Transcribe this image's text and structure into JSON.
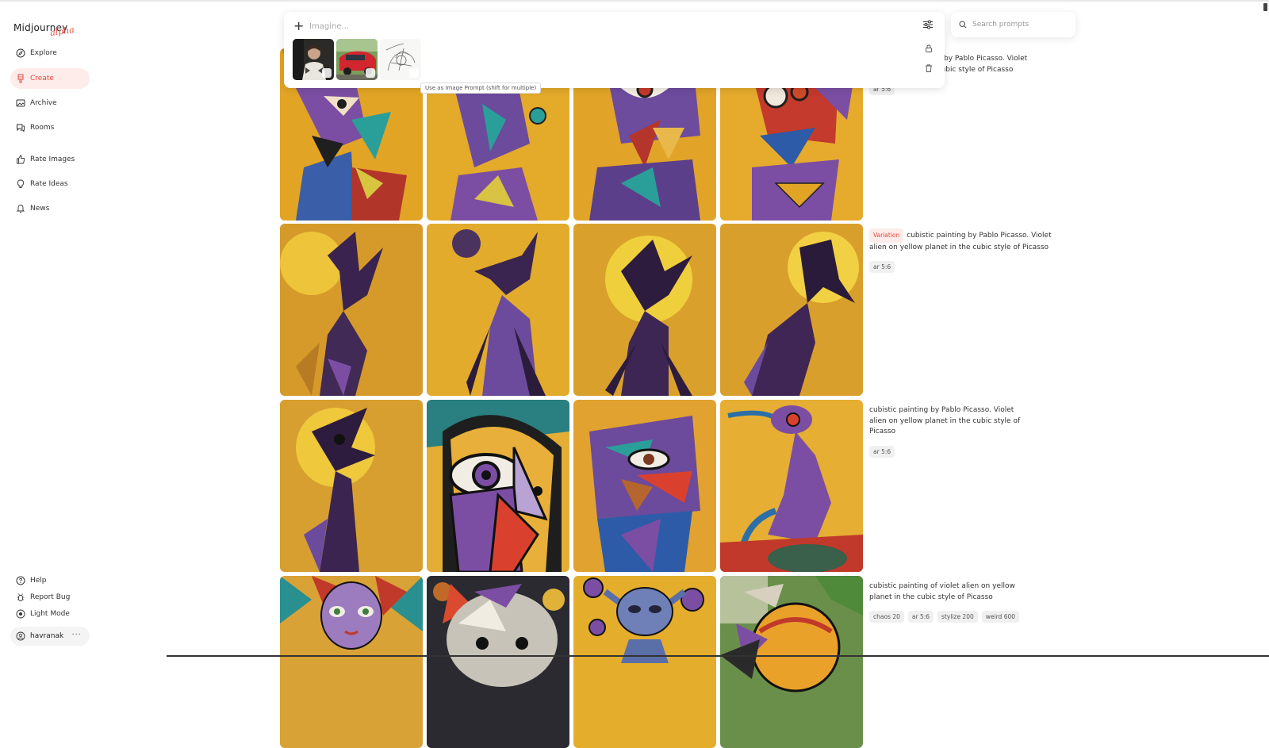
{
  "app": {
    "logo_text": "Midjourney",
    "logo_badge": "alpha",
    "accent": "#e2493d"
  },
  "sidebar": {
    "items": [
      {
        "label": "Explore",
        "icon": "compass-icon"
      },
      {
        "label": "Create",
        "icon": "brush-icon",
        "active": true
      },
      {
        "label": "Archive",
        "icon": "image-icon"
      },
      {
        "label": "Rooms",
        "icon": "chat-icon"
      },
      {
        "label": "Rate Images",
        "icon": "thumbs-up-icon"
      },
      {
        "label": "Rate Ideas",
        "icon": "lightbulb-icon"
      },
      {
        "label": "News",
        "icon": "bell-icon"
      }
    ],
    "footer": [
      {
        "label": "Help",
        "icon": "help-icon"
      },
      {
        "label": "Report Bug",
        "icon": "bug-icon"
      },
      {
        "label": "Light Mode",
        "icon": "sun-icon"
      }
    ],
    "user": {
      "name": "havranak",
      "more": "···"
    }
  },
  "imagine": {
    "placeholder": "Imagine...",
    "tooltip": "Use as Image Prompt (shift for multiple)"
  },
  "search": {
    "placeholder": "Search prompts"
  },
  "rows": [
    {
      "badge": "",
      "prompt_visible": "nting by Pablo Picasso. Violet",
      "prompt_line2": "the cubic style of Picasso",
      "tags": [
        "ar 5:6"
      ]
    },
    {
      "badge": "Variation",
      "prompt": "cubistic painting by Pablo Picasso. Violet alien on yellow planet in the cubic style of Picasso",
      "tags": [
        "ar 5:6"
      ]
    },
    {
      "badge": "",
      "prompt": "cubistic painting by Pablo Picasso. Violet alien on yellow planet in the cubic style of Picasso",
      "tags": [
        "ar 5:6"
      ]
    },
    {
      "badge": "",
      "prompt": "cubistic painting of violet alien on yellow planet in the cubic style of Picasso",
      "tags": [
        "chaos 20",
        "ar 5:6",
        "stylize 200",
        "weird 600"
      ]
    }
  ]
}
